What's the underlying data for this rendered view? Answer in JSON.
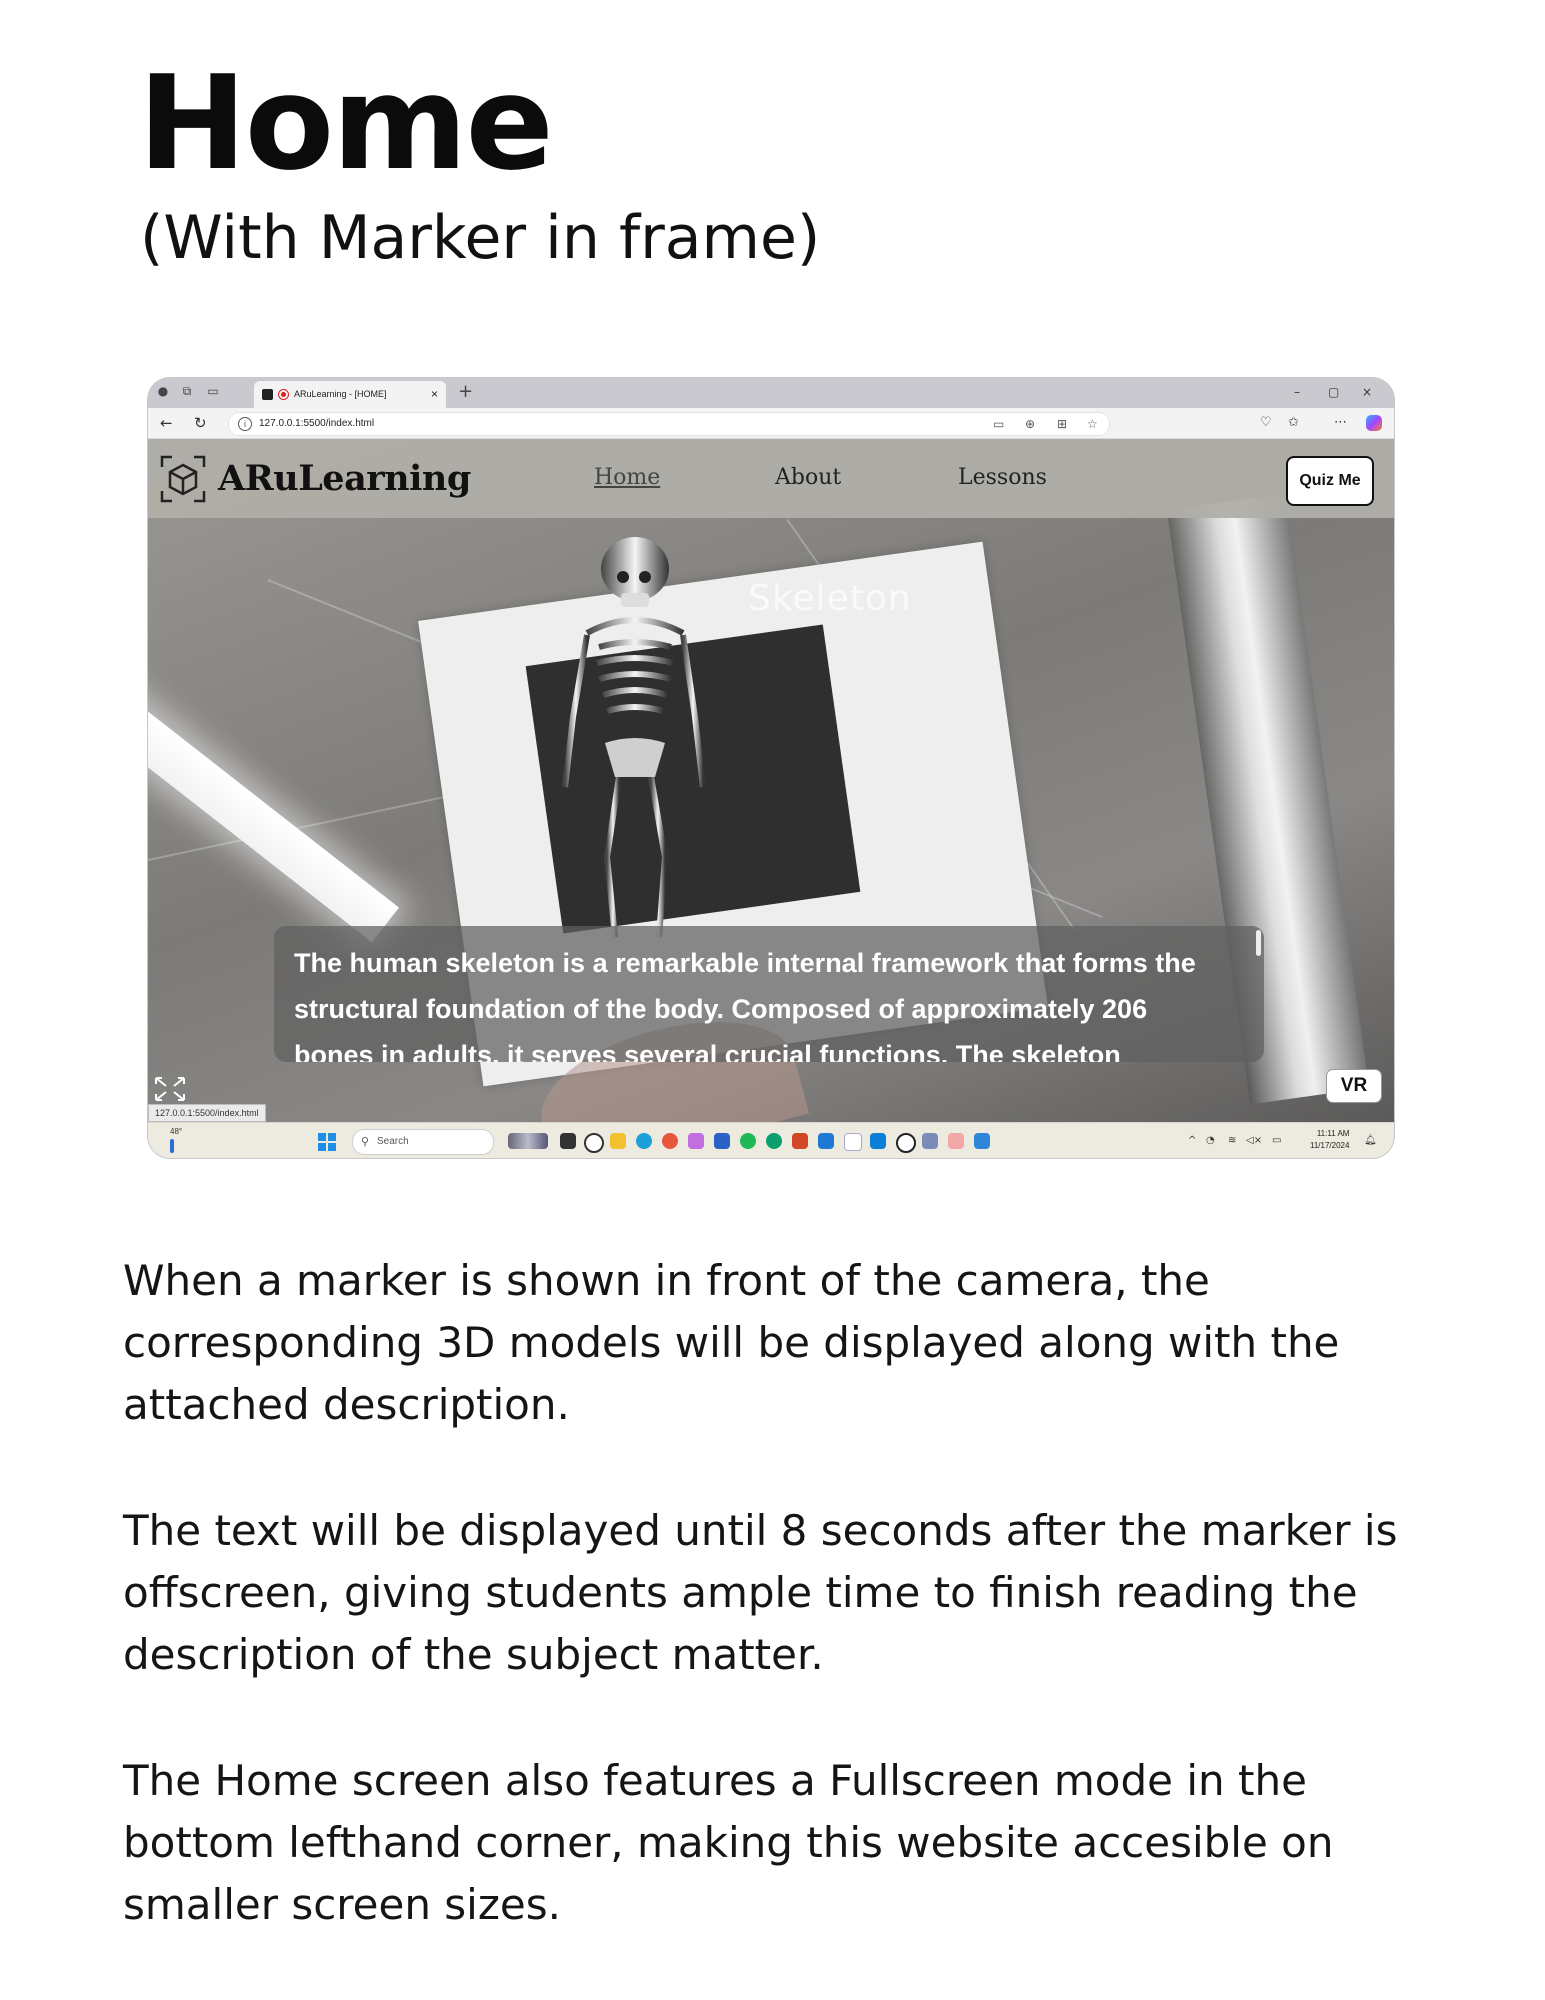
{
  "page": {
    "title": "Home",
    "subtitle": "(With Marker in frame)"
  },
  "browser": {
    "tab_title": "ARuLearning - [HOME]",
    "new_tab_symbol": "+",
    "close_symbol": "×",
    "url": "127.0.0.1:5500/index.html",
    "status_url": "127.0.0.1:5500/index.html"
  },
  "site": {
    "brand": "ARuLearning",
    "nav": [
      "Home",
      "About",
      "Lessons"
    ],
    "active_nav": "Home",
    "quiz_button": "Quiz Me",
    "model_label": "Skeleton",
    "description": "The human skeleton is a remarkable internal framework that forms the structural foundation of the body. Composed of approximately 206 bones in adults. it serves several crucial functions. The skeleton",
    "vr_button": "VR"
  },
  "taskbar": {
    "weather": "48°",
    "search_placeholder": "Search",
    "time": "11:11 AM",
    "date": "11/17/2024"
  },
  "explanation": [
    "When a marker is shown in front of the camera, the corresponding 3D models will be displayed along with the attached description.",
    "The text will be displayed until 8 seconds after the marker is offscreen, giving students ample time to finish reading the description of the subject matter.",
    "The Home screen also features a Fullscreen mode in the bottom lefthand corner, making this website accesible on smaller screen sizes."
  ],
  "icons": [
    "profile-icon",
    "workspaces-icon",
    "tab-actions-icon",
    "favicon-icon",
    "recording-icon",
    "back-icon",
    "refresh-icon",
    "info-icon",
    "fullscreen-icon",
    "windows-start-icon",
    "search-icon",
    "bell-icon"
  ]
}
